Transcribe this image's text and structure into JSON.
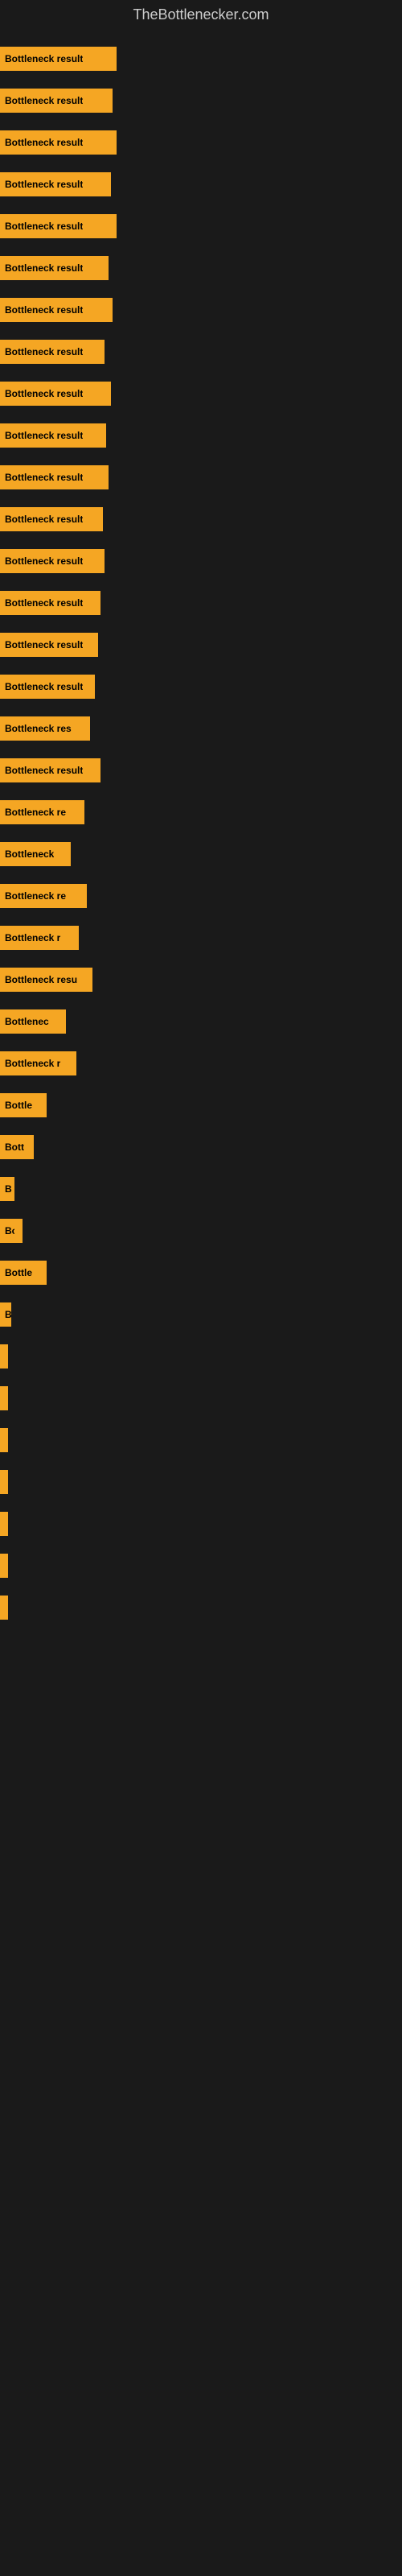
{
  "site": {
    "title": "TheBottlenecker.com"
  },
  "bars": [
    {
      "label": "Bottleneck result",
      "width": 145
    },
    {
      "label": "Bottleneck result",
      "width": 140
    },
    {
      "label": "Bottleneck result",
      "width": 145
    },
    {
      "label": "Bottleneck result",
      "width": 138
    },
    {
      "label": "Bottleneck result",
      "width": 145
    },
    {
      "label": "Bottleneck result",
      "width": 135
    },
    {
      "label": "Bottleneck result",
      "width": 140
    },
    {
      "label": "Bottleneck result",
      "width": 130
    },
    {
      "label": "Bottleneck result",
      "width": 138
    },
    {
      "label": "Bottleneck result",
      "width": 132
    },
    {
      "label": "Bottleneck result",
      "width": 135
    },
    {
      "label": "Bottleneck result",
      "width": 128
    },
    {
      "label": "Bottleneck result",
      "width": 130
    },
    {
      "label": "Bottleneck result",
      "width": 125
    },
    {
      "label": "Bottleneck result",
      "width": 122
    },
    {
      "label": "Bottleneck result",
      "width": 118
    },
    {
      "label": "Bottleneck res",
      "width": 112
    },
    {
      "label": "Bottleneck result",
      "width": 125
    },
    {
      "label": "Bottleneck re",
      "width": 105
    },
    {
      "label": "Bottleneck",
      "width": 88
    },
    {
      "label": "Bottleneck re",
      "width": 108
    },
    {
      "label": "Bottleneck r",
      "width": 98
    },
    {
      "label": "Bottleneck resu",
      "width": 115
    },
    {
      "label": "Bottlenec",
      "width": 82
    },
    {
      "label": "Bottleneck r",
      "width": 95
    },
    {
      "label": "Bottle",
      "width": 58
    },
    {
      "label": "Bott",
      "width": 42
    },
    {
      "label": "B",
      "width": 18
    },
    {
      "label": "Bo",
      "width": 28
    },
    {
      "label": "Bottle",
      "width": 58
    },
    {
      "label": "B",
      "width": 14
    },
    {
      "label": "",
      "width": 10
    },
    {
      "label": "",
      "width": 10
    },
    {
      "label": "",
      "width": 10
    },
    {
      "label": "",
      "width": 10
    },
    {
      "label": "",
      "width": 10
    },
    {
      "label": "",
      "width": 10
    },
    {
      "label": "",
      "width": 10
    }
  ],
  "colors": {
    "bar": "#f5a623",
    "background": "#1a1a1a",
    "title": "#cccccc",
    "bar_text": "#000000"
  }
}
